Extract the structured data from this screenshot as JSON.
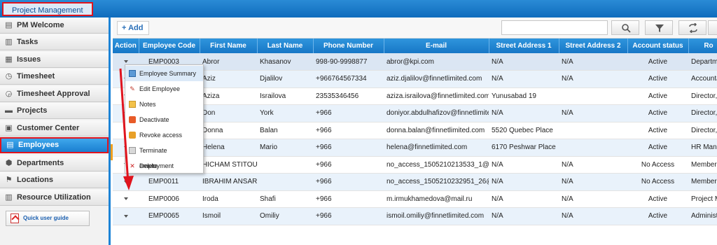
{
  "app": {
    "title": "Project Management"
  },
  "sidebar": {
    "items": [
      {
        "label": "PM Welcome",
        "icon": "home-icon"
      },
      {
        "label": "Tasks",
        "icon": "tasks-icon"
      },
      {
        "label": "Issues",
        "icon": "issues-icon"
      },
      {
        "label": "Timesheet",
        "icon": "clock-icon"
      },
      {
        "label": "Timesheet Approval",
        "icon": "approval-icon"
      },
      {
        "label": "Projects",
        "icon": "folder-icon"
      },
      {
        "label": "Customer Center",
        "icon": "customer-icon"
      },
      {
        "label": "Employees",
        "icon": "employees-icon",
        "active": true
      },
      {
        "label": "Departments",
        "icon": "departments-icon"
      },
      {
        "label": "Locations",
        "icon": "location-icon"
      },
      {
        "label": "Resource Utilization",
        "icon": "chart-icon"
      }
    ],
    "guide_label": "Quick user guide"
  },
  "toolbar": {
    "add_label": "+ Add",
    "search_value": ""
  },
  "table": {
    "columns": [
      "Action",
      "Employee Code",
      "First Name",
      "Last Name",
      "Phone Number",
      "E-mail",
      "Street Address 1",
      "Street Address 2",
      "Account status",
      "Ro"
    ],
    "rows": [
      [
        "",
        "EMP0003",
        "Abror",
        "Khasanov",
        "998-90-9998877",
        "abror@kpi.com",
        "N/A",
        "N/A",
        "Active",
        "Departme"
      ],
      [
        "",
        "",
        "Aziz",
        "Djalilov",
        "+966764567334",
        "aziz.djalilov@finnetlimited.com",
        "N/A",
        "N/A",
        "Active",
        "Accountar"
      ],
      [
        "",
        "",
        "Aziza",
        "Israilova",
        "23535346456",
        "aziza.israilova@finnetlimited.com",
        "Yunusabad 19",
        "",
        "Active",
        "Director, T"
      ],
      [
        "",
        "",
        "Don",
        "York",
        "+966",
        "doniyor.abdulhafizov@finnetlimited.co",
        "N/A",
        "N/A",
        "Active",
        "Director, D"
      ],
      [
        "",
        "",
        "Donna",
        "Balan",
        "+966",
        "donna.balan@finnetlimited.com",
        "5520 Quebec Place",
        "",
        "Active",
        "Director, M"
      ],
      [
        "",
        "",
        "Helena",
        "Mario",
        "+966",
        "helena@finnetlimited.com",
        "6170 Peshwar Place",
        "",
        "Active",
        "HR Manag"
      ],
      [
        "",
        "",
        "HICHAM STITOU",
        "",
        "+966",
        "no_access_1505210213533_1@work",
        "N/A",
        "N/A",
        "No Access",
        "Member"
      ],
      [
        "",
        "EMP0011",
        "IBRAHIM ANSARI",
        "",
        "+966",
        "no_access_1505210232951_26@wor",
        "N/A",
        "N/A",
        "No Access",
        "Member"
      ],
      [
        "",
        "EMP0006",
        "Iroda",
        "Shafi",
        "+966",
        "m.irmukhamedova@mail.ru",
        "N/A",
        "N/A",
        "Active",
        "Project Ma"
      ],
      [
        "",
        "EMP0065",
        "Ismoil",
        "Omiliy",
        "+966",
        "ismoil.omiliy@finnetlimited.com",
        "N/A",
        "N/A",
        "Active",
        "Administra"
      ]
    ]
  },
  "action_menu": {
    "items": [
      {
        "label": "Employee Summary",
        "icon": "summary-icon"
      },
      {
        "label": "Edit Employee",
        "icon": "edit-icon"
      },
      {
        "label": "Notes",
        "icon": "notes-icon"
      },
      {
        "label": "Deactivate",
        "icon": "deactivate-icon"
      },
      {
        "label": "Revoke access",
        "icon": "revoke-icon"
      },
      {
        "label": "Terminate employment",
        "icon": "terminate-icon"
      },
      {
        "label": "Delete",
        "icon": "delete-icon"
      }
    ]
  },
  "colors": {
    "accent": "#1777c6",
    "highlight": "#e0141e"
  }
}
